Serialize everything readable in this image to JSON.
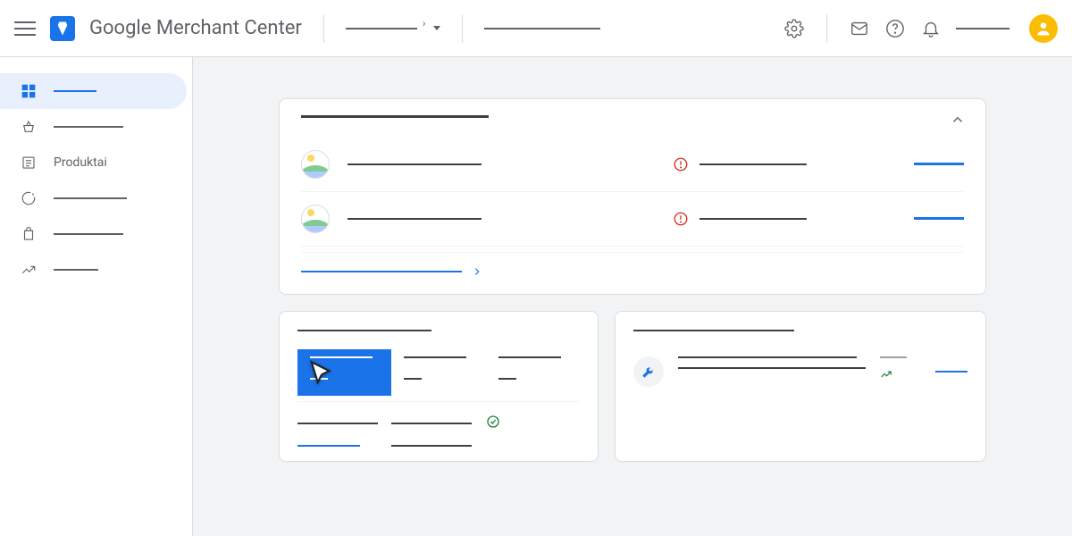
{
  "header": {
    "app_title": "Google Merchant Center",
    "account_selector": "",
    "search_placeholder": ""
  },
  "sidebar": {
    "items": [
      {
        "label": "",
        "id": "overview",
        "active": true
      },
      {
        "label": "",
        "id": "shopping"
      },
      {
        "label": "Produktai",
        "id": "products"
      },
      {
        "label": "",
        "id": "performance"
      },
      {
        "label": "",
        "id": "growth"
      },
      {
        "label": "",
        "id": "trends"
      }
    ]
  },
  "card_main": {
    "title": "",
    "items": [
      {
        "name": "",
        "status_text": "",
        "status": "error",
        "action": ""
      },
      {
        "name": "",
        "status_text": "",
        "status": "error",
        "action": ""
      }
    ],
    "footer_link": ""
  },
  "card_metrics": {
    "title": "",
    "metrics": [
      {
        "label": "",
        "value": "",
        "selected": true
      },
      {
        "label": "",
        "value": ""
      },
      {
        "label": "",
        "value": ""
      }
    ],
    "row2": {
      "left": "",
      "mid": "",
      "status": "ok"
    },
    "row3": {
      "left": "",
      "mid": ""
    }
  },
  "card_insight": {
    "title": "",
    "item": {
      "line1": "",
      "line2": "",
      "meta": "",
      "trend": "up",
      "link": ""
    }
  }
}
